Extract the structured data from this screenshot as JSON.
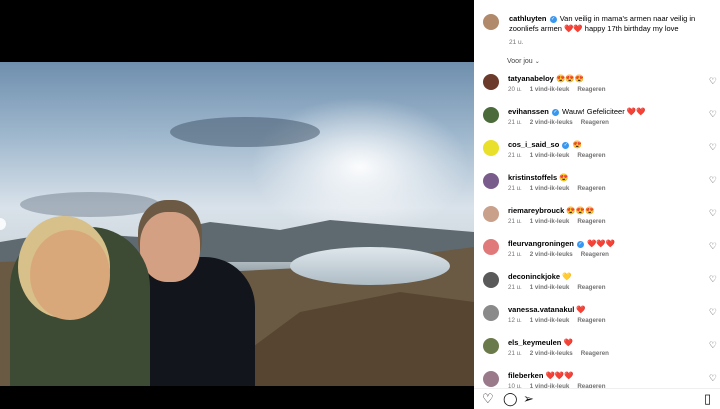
{
  "post": {
    "username": "cathluyten",
    "caption": "Van veilig in mama's armen naar veilig in zoonliefs armen ❤️❤️ happy 17th birthday my love",
    "time": "21 u."
  },
  "for_you": {
    "label": "Voor jou"
  },
  "comments": [
    {
      "user": "tatyanabeloy",
      "verified": false,
      "text": "😍😍😍",
      "time": "20 u.",
      "likes": "1 vind-ik-leuk",
      "reply": "Reageren",
      "avatar_color": "#6b3a2a"
    },
    {
      "user": "evihanssen",
      "verified": true,
      "text": "Wauw! Gefeliciteer ❤️❤️",
      "time": "21 u.",
      "likes": "2 vind-ik-leuks",
      "reply": "Reageren",
      "avatar_color": "#4b6b3a"
    },
    {
      "user": "cos_i_said_so",
      "verified": true,
      "text": "😍",
      "time": "21 u.",
      "likes": "1 vind-ik-leuk",
      "reply": "Reageren",
      "avatar_color": "#e8e02a"
    },
    {
      "user": "kristinstoffels",
      "verified": false,
      "text": "😍",
      "time": "21 u.",
      "likes": "1 vind-ik-leuk",
      "reply": "Reageren",
      "avatar_color": "#7a5c8c"
    },
    {
      "user": "riemareybrouck",
      "verified": false,
      "text": "😍😍😍",
      "time": "21 u.",
      "likes": "1 vind-ik-leuk",
      "reply": "Reageren",
      "avatar_color": "#c9a08a"
    },
    {
      "user": "fleurvangroningen",
      "verified": true,
      "text": "❤️❤️❤️",
      "time": "21 u.",
      "likes": "2 vind-ik-leuks",
      "reply": "Reageren",
      "avatar_color": "#e07a7a"
    },
    {
      "user": "deconinckjoke",
      "verified": false,
      "text": "💛",
      "time": "21 u.",
      "likes": "1 vind-ik-leuk",
      "reply": "Reageren",
      "avatar_color": "#5a5a5a"
    },
    {
      "user": "vanessa.vatanakul",
      "verified": false,
      "text": "❤️",
      "time": "12 u.",
      "likes": "1 vind-ik-leuk",
      "reply": "Reageren",
      "avatar_color": "#8a8a8a"
    },
    {
      "user": "els_keymeulen",
      "verified": false,
      "text": "❤️",
      "time": "21 u.",
      "likes": "2 vind-ik-leuks",
      "reply": "Reageren",
      "avatar_color": "#6a7a4a"
    },
    {
      "user": "fileberken",
      "verified": false,
      "text": "❤️❤️❤️",
      "time": "10 u.",
      "likes": "1 vind-ik-leuk",
      "reply": "Reageren",
      "avatar_color": "#9a7a8a"
    }
  ],
  "icons": {
    "comment_like": "heart-outline-icon",
    "post_like": "heart-outline-icon",
    "comment": "speech-bubble-icon",
    "share": "paper-plane-icon",
    "save": "bookmark-icon"
  },
  "colors": {
    "verified": "#3897f0",
    "secondary_text": "#737373",
    "heart_red": "#ed4956"
  }
}
